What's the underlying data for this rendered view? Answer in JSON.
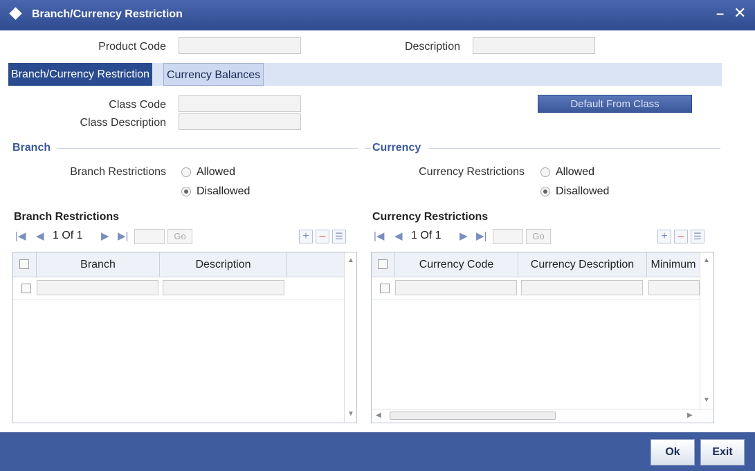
{
  "window": {
    "title": "Branch/Currency Restriction"
  },
  "header": {
    "product_code_label": "Product Code",
    "product_code_value": "",
    "description_label": "Description",
    "description_value": ""
  },
  "tabs": [
    {
      "label": "Branch/Currency Restriction",
      "active": true
    },
    {
      "label": "Currency Balances",
      "active": false
    }
  ],
  "class": {
    "class_code_label": "Class Code",
    "class_code_value": "",
    "class_description_label": "Class Description",
    "class_description_value": "",
    "default_button": "Default From Class"
  },
  "branch": {
    "section": "Branch",
    "restrictions_label": "Branch Restrictions",
    "options": [
      "Allowed",
      "Disallowed"
    ],
    "selected": "Disallowed",
    "grid_title": "Branch Restrictions",
    "pager": "1 Of 1",
    "go": "Go",
    "columns": [
      "Branch",
      "Description"
    ]
  },
  "currency": {
    "section": "Currency",
    "restrictions_label": "Currency Restrictions",
    "options": [
      "Allowed",
      "Disallowed"
    ],
    "selected": "Disallowed",
    "grid_title": "Currency Restrictions",
    "pager": "1 Of 1",
    "go": "Go",
    "columns": [
      "Currency Code",
      "Currency Description",
      "Minimum"
    ]
  },
  "footer": {
    "ok": "Ok",
    "exit": "Exit"
  },
  "colors": {
    "titlebar": "#2f4b90",
    "active_tab": "#2a4b8f",
    "section_heading": "#3b5899",
    "footer": "#3f5c9e"
  }
}
